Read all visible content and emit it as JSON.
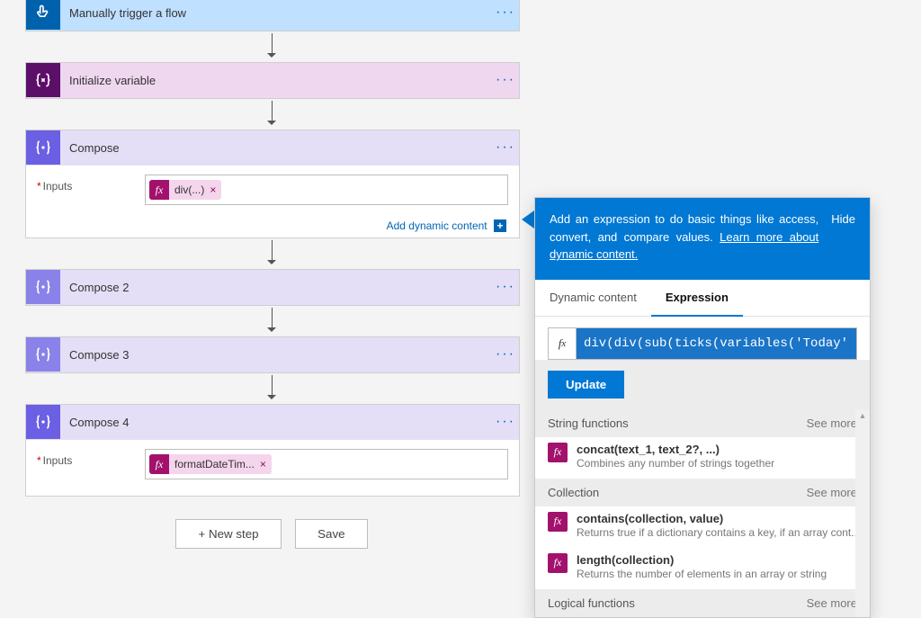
{
  "flow": {
    "trigger": {
      "title": "Manually trigger a flow"
    },
    "init_var": {
      "title": "Initialize variable"
    },
    "compose": {
      "title": "Compose",
      "inputs_label": "Inputs",
      "chip": "div(...)",
      "add_dyn": "Add dynamic content"
    },
    "compose2": {
      "title": "Compose 2"
    },
    "compose3": {
      "title": "Compose 3"
    },
    "compose4": {
      "title": "Compose 4",
      "inputs_label": "Inputs",
      "chip": "formatDateTim..."
    },
    "new_step": "+ New step",
    "save": "Save"
  },
  "panel": {
    "intro": "Add an expression to do basic things like access, convert, and compare values. ",
    "learn_more": "Learn more about dynamic content.",
    "hide": "Hide",
    "tab_dyn": "Dynamic content",
    "tab_expr": "Expression",
    "expr_value": "div(div(sub(ticks(variables('Today')),tick",
    "update": "Update",
    "sections": {
      "string": {
        "title": "String functions",
        "see": "See more"
      },
      "collection": {
        "title": "Collection",
        "see": "See more"
      },
      "logical": {
        "title": "Logical functions",
        "see": "See more"
      }
    },
    "fns": {
      "concat": {
        "name": "concat(text_1, text_2?, ...)",
        "desc": "Combines any number of strings together"
      },
      "contains": {
        "name": "contains(collection, value)",
        "desc": "Returns true if a dictionary contains a key, if an array cont..."
      },
      "length": {
        "name": "length(collection)",
        "desc": "Returns the number of elements in an array or string"
      }
    }
  }
}
